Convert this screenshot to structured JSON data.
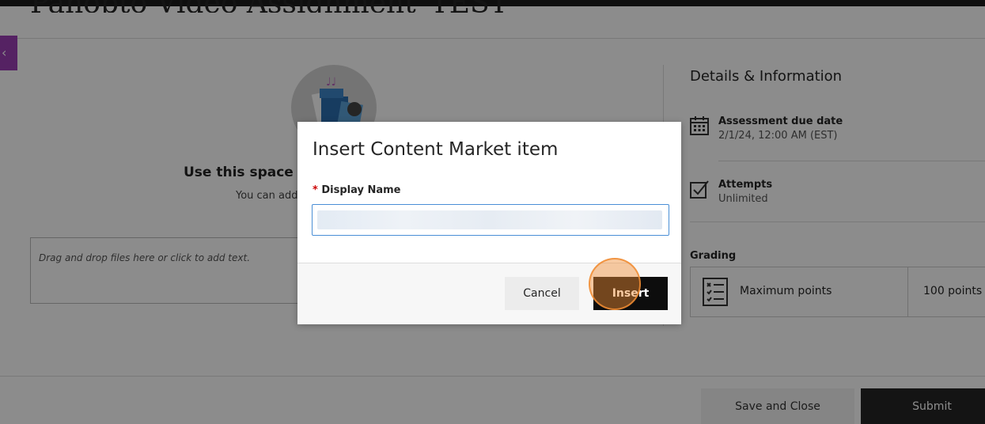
{
  "page": {
    "title": "Panopto Video Assignment_TEST",
    "side_tab_glyph": "‹"
  },
  "instructions": {
    "title": "Use this space to",
    "subtitle": "You can add"
  },
  "dropzone": {
    "placeholder": "Drag and drop files here or click to add text."
  },
  "details": {
    "heading": "Details & Information",
    "due": {
      "label": "Assessment due date",
      "value": "2/1/24, 12:00 AM (EST)",
      "icon": "calendar-icon"
    },
    "attempts": {
      "label": "Attempts",
      "value": "Unlimited",
      "icon": "checkbox-icon"
    }
  },
  "grading": {
    "heading": "Grading",
    "label": "Maximum points",
    "value": "100 points",
    "icon": "checklist-icon"
  },
  "footer": {
    "save_label": "Save and Close",
    "submit_label": "Submit"
  },
  "modal": {
    "title": "Insert Content Market item",
    "field_required_mark": "*",
    "field_label": "Display Name",
    "field_value": "",
    "cancel_label": "Cancel",
    "insert_label": "Insert"
  },
  "colors": {
    "accent_purple": "#9b3fb5",
    "dark_button": "#0d0d0d",
    "click_marker": "#f08c32"
  }
}
